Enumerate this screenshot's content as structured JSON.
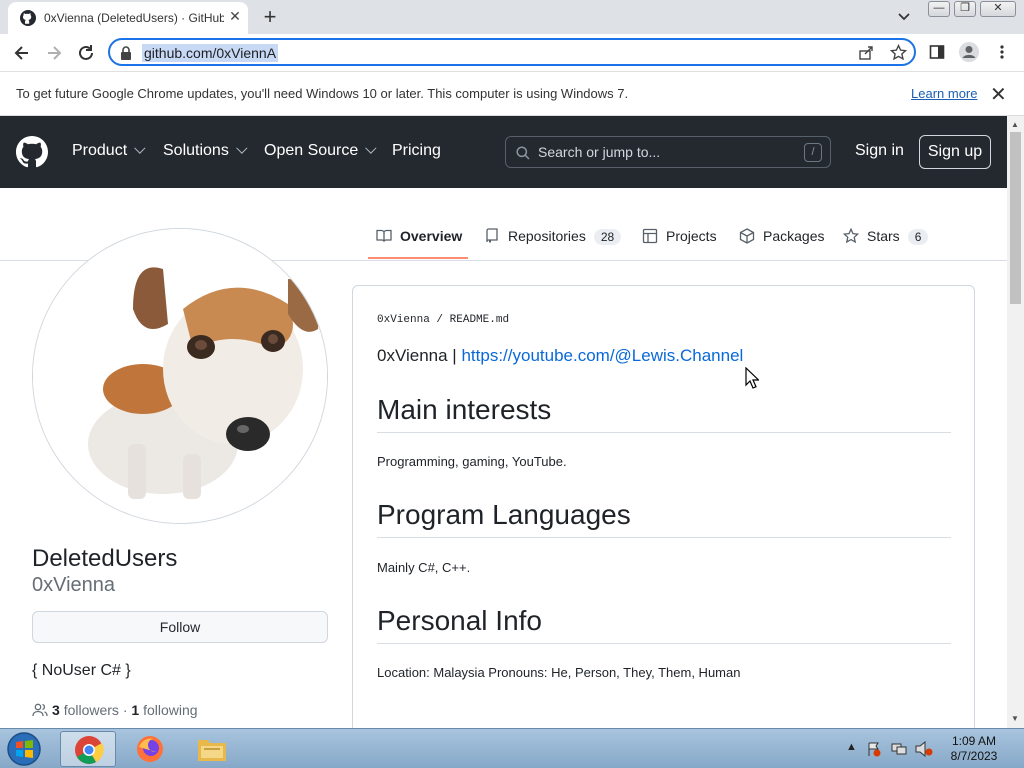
{
  "browser": {
    "tab_title": "0xVienna (DeletedUsers) · GitHub",
    "tab_close": "✕",
    "new_tab": "+",
    "url": "github.com/0xViennA",
    "window_controls": [
      "—",
      "❐",
      "✕"
    ]
  },
  "infobar": {
    "message": "To get future Google Chrome updates, you'll need Windows 10 or later. This computer is using Windows 7.",
    "learn_more": "Learn more",
    "close": "✕"
  },
  "github_header": {
    "nav": [
      "Product",
      "Solutions",
      "Open Source",
      "Pricing"
    ],
    "search_placeholder": "Search or jump to...",
    "search_shortcut": "/",
    "sign_in": "Sign in",
    "sign_up": "Sign up"
  },
  "profile_tabs": [
    {
      "label": "Overview",
      "icon": "book-icon",
      "count": null
    },
    {
      "label": "Repositories",
      "icon": "repo-icon",
      "count": "28"
    },
    {
      "label": "Projects",
      "icon": "table-icon",
      "count": null
    },
    {
      "label": "Packages",
      "icon": "package-icon",
      "count": null
    },
    {
      "label": "Stars",
      "icon": "star-icon",
      "count": "6"
    }
  ],
  "profile": {
    "display_name": "DeletedUsers",
    "username": "0xVienna",
    "follow_label": "Follow",
    "bio": "{ NoUser C# }",
    "followers_count": "3",
    "followers_label": "followers",
    "separator": "·",
    "following_count": "1",
    "following_label": "following"
  },
  "readme": {
    "path_user": "0xVienna",
    "path_sep": "/",
    "path_file": "README.md",
    "tagline_prefix": "0xVienna |",
    "tagline_link": "https://youtube.com/@Lewis.Channel",
    "sections": [
      {
        "heading": "Main interests",
        "body": "Programming, gaming, YouTube."
      },
      {
        "heading": "Program Languages",
        "body": "Mainly C#, C++."
      },
      {
        "heading": "Personal Info",
        "body": "Location: Malaysia Pronouns: He, Person, They, Them, Human"
      }
    ]
  },
  "taskbar": {
    "time": "1:09 AM",
    "date": "8/7/2023",
    "tray_arrow": "▲"
  },
  "colors": {
    "github_header": "#24292f",
    "link": "#0969da",
    "tab_underline": "#fd8c73",
    "omnibox_focus": "#1a73e8"
  }
}
